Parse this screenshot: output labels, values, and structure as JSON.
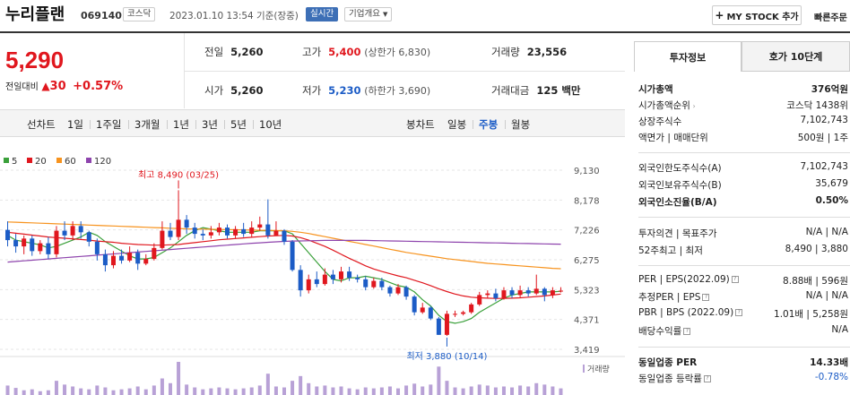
{
  "header": {
    "name": "누리플랜",
    "code": "069140",
    "market": "코스닥",
    "datetime": "2023.01.10 13:54 기준(장중)",
    "realtime": "실시간",
    "overview": "기업개요",
    "overview_icon": "chevron-down-icon",
    "mystock": "MY STOCK 추가",
    "quick": "빠른주문"
  },
  "price": {
    "current": "5,290",
    "diff_label": "전일대비",
    "diff": "30",
    "rate": "+0.57%",
    "up_color": "#e0171e",
    "down_color": "#1c5cc6"
  },
  "quote": {
    "prev_label": "전일",
    "prev": "5,260",
    "high_label": "고가",
    "high": "5,400",
    "upper_limit": "(상한가 6,830)",
    "volume_label": "거래량",
    "volume": "23,556",
    "open_label": "시가",
    "open": "5,260",
    "low_label": "저가",
    "low": "5,230",
    "lower_limit": "(하한가 3,690)",
    "amount_label": "거래대금",
    "amount": "125 백만"
  },
  "period": {
    "line_label": "선차트",
    "line_items": [
      "1일",
      "1주일",
      "3개월",
      "1년",
      "3년",
      "5년",
      "10년"
    ],
    "candle_label": "봉차트",
    "candle_items": [
      "일봉",
      "주봉",
      "월봉"
    ],
    "candle_selected": "주봉"
  },
  "chart_data": {
    "type": "candlestick",
    "legend": [
      {
        "name": "5",
        "color": "#3aa03a"
      },
      {
        "name": "20",
        "color": "#e0171e"
      },
      {
        "name": "60",
        "color": "#f7931e"
      },
      {
        "name": "120",
        "color": "#8e44ad"
      }
    ],
    "y_ticks": [
      "9,130",
      "8,178",
      "7,226",
      "6,275",
      "5,323",
      "4,371",
      "3,419"
    ],
    "ylim": [
      3419,
      9130
    ],
    "high_label": "최고 8,490 (03/25)",
    "low_label": "최저 3,880 (10/14)",
    "volume_label": "거래량",
    "candles": [
      [
        7226,
        6900,
        7500,
        6700
      ],
      [
        6900,
        6700,
        7100,
        6500
      ],
      [
        6700,
        6950,
        7050,
        6450
      ],
      [
        6950,
        6550,
        7050,
        6400
      ],
      [
        6550,
        6800,
        6900,
        6450
      ],
      [
        6800,
        6450,
        7000,
        6300
      ],
      [
        6450,
        7200,
        7350,
        6350
      ],
      [
        7200,
        7050,
        7500,
        6900
      ],
      [
        7050,
        7350,
        7500,
        6900
      ],
      [
        7350,
        7150,
        7500,
        6950
      ],
      [
        7150,
        6850,
        7200,
        6700
      ],
      [
        6850,
        6450,
        6950,
        6250
      ],
      [
        6450,
        6100,
        6600,
        5900
      ],
      [
        6100,
        6400,
        6550,
        6000
      ],
      [
        6400,
        6250,
        6600,
        6150
      ],
      [
        6250,
        6500,
        6700,
        6200
      ],
      [
        6500,
        6150,
        6600,
        5950
      ],
      [
        6150,
        6300,
        6450,
        6100
      ],
      [
        6300,
        6650,
        6800,
        6250
      ],
      [
        6650,
        7200,
        7500,
        6600
      ],
      [
        7200,
        7000,
        7450,
        6900
      ],
      [
        7000,
        7550,
        8490,
        6900
      ],
      [
        7550,
        7300,
        7700,
        7100
      ],
      [
        7300,
        7100,
        7450,
        6950
      ],
      [
        7100,
        7050,
        7250,
        6900
      ],
      [
        7050,
        7150,
        7350,
        6950
      ],
      [
        7150,
        7300,
        7450,
        7050
      ],
      [
        7300,
        7050,
        7400,
        6950
      ],
      [
        7050,
        7250,
        7350,
        6950
      ],
      [
        7250,
        7100,
        7450,
        7000
      ],
      [
        7100,
        7300,
        7500,
        7000
      ],
      [
        7300,
        7400,
        7650,
        7200
      ],
      [
        7400,
        7050,
        8200,
        6950
      ],
      [
        7050,
        7200,
        7500,
        7050
      ],
      [
        7200,
        6850,
        7250,
        6750
      ],
      [
        6850,
        5950,
        6900,
        5900
      ],
      [
        5950,
        5300,
        6100,
        5100
      ],
      [
        5300,
        5650,
        5800,
        5200
      ],
      [
        5650,
        5500,
        5900,
        5400
      ],
      [
        5500,
        5800,
        6000,
        5450
      ],
      [
        5800,
        5650,
        5950,
        5500
      ],
      [
        5650,
        5900,
        6050,
        5550
      ],
      [
        5900,
        5700,
        6050,
        5600
      ],
      [
        5700,
        5650,
        5800,
        5550
      ],
      [
        5650,
        5400,
        5750,
        5300
      ],
      [
        5400,
        5600,
        5700,
        5350
      ],
      [
        5600,
        5400,
        5700,
        5300
      ],
      [
        5400,
        5200,
        5450,
        5100
      ],
      [
        5200,
        5400,
        5500,
        5150
      ],
      [
        5400,
        5100,
        5450,
        5000
      ],
      [
        5100,
        4600,
        5150,
        4500
      ],
      [
        4600,
        4750,
        4900,
        4550
      ],
      [
        4750,
        4400,
        4800,
        4350
      ],
      [
        4400,
        3880,
        4450,
        3880
      ],
      [
        3880,
        4550,
        4650,
        3850
      ],
      [
        4550,
        4550,
        4650,
        4450
      ],
      [
        4550,
        4600,
        4650,
        4500
      ],
      [
        4600,
        4850,
        4900,
        4550
      ],
      [
        4850,
        5150,
        5250,
        4800
      ],
      [
        5150,
        5200,
        5300,
        5050
      ],
      [
        5200,
        5050,
        5350,
        4950
      ],
      [
        5050,
        5300,
        5400,
        5000
      ],
      [
        5300,
        5150,
        5400,
        5050
      ],
      [
        5150,
        5300,
        5450,
        5050
      ],
      [
        5300,
        5200,
        5400,
        5100
      ],
      [
        5200,
        5350,
        5800,
        5150
      ],
      [
        5350,
        5150,
        5400,
        4950
      ],
      [
        5150,
        5300,
        5400,
        5050
      ],
      [
        5260,
        5290,
        5400,
        5230
      ]
    ],
    "ma": {
      "5": [
        7050,
        6900,
        6850,
        6800,
        6750,
        6650,
        6700,
        6800,
        6900,
        7000,
        7150,
        7050,
        6850,
        6700,
        6550,
        6400,
        6300,
        6300,
        6350,
        6500,
        6650,
        6850,
        7050,
        7200,
        7300,
        7250,
        7200,
        7150,
        7150,
        7150,
        7150,
        7200,
        7200,
        7200,
        7200,
        7100,
        6800,
        6500,
        6200,
        5900,
        5650,
        5600,
        5700,
        5700,
        5750,
        5700,
        5650,
        5550,
        5450,
        5400,
        5250,
        5000,
        4800,
        4500,
        4300,
        4250,
        4300,
        4400,
        4600,
        4750,
        4900,
        5050,
        5150,
        5200,
        5250,
        5250,
        5250,
        5250,
        5270
      ],
      "20": [
        7150,
        7120,
        7090,
        7060,
        7030,
        7000,
        6980,
        6960,
        6940,
        6920,
        6900,
        6870,
        6850,
        6830,
        6800,
        6780,
        6760,
        6750,
        6740,
        6740,
        6750,
        6760,
        6790,
        6820,
        6850,
        6880,
        6910,
        6930,
        6950,
        6970,
        6990,
        7010,
        7030,
        7040,
        7050,
        7030,
        6980,
        6900,
        6800,
        6700,
        6580,
        6450,
        6320,
        6200,
        6080,
        5980,
        5900,
        5830,
        5760,
        5700,
        5620,
        5540,
        5450,
        5350,
        5260,
        5180,
        5120,
        5080,
        5060,
        5050,
        5040,
        5040,
        5050,
        5060,
        5080,
        5100,
        5120,
        5150,
        5180
      ],
      "60": [
        7480,
        7470,
        7460,
        7450,
        7440,
        7430,
        7420,
        7410,
        7400,
        7390,
        7380,
        7370,
        7360,
        7350,
        7340,
        7330,
        7320,
        7310,
        7300,
        7290,
        7280,
        7270,
        7260,
        7255,
        7250,
        7245,
        7240,
        7235,
        7230,
        7225,
        7220,
        7215,
        7210,
        7205,
        7200,
        7180,
        7150,
        7110,
        7060,
        7010,
        6960,
        6910,
        6860,
        6810,
        6760,
        6710,
        6660,
        6610,
        6560,
        6510,
        6470,
        6430,
        6390,
        6350,
        6310,
        6280,
        6250,
        6220,
        6190,
        6160,
        6140,
        6120,
        6100,
        6080,
        6060,
        6040,
        6020,
        6000,
        5990
      ],
      "120": [
        6200,
        6220,
        6240,
        6260,
        6280,
        6300,
        6320,
        6340,
        6360,
        6380,
        6400,
        6420,
        6440,
        6460,
        6480,
        6500,
        6520,
        6540,
        6560,
        6580,
        6600,
        6620,
        6640,
        6660,
        6680,
        6700,
        6720,
        6740,
        6760,
        6780,
        6800,
        6815,
        6830,
        6845,
        6860,
        6870,
        6875,
        6880,
        6885,
        6890,
        6890,
        6890,
        6890,
        6890,
        6890,
        6885,
        6880,
        6875,
        6870,
        6865,
        6860,
        6855,
        6850,
        6845,
        6840,
        6835,
        6830,
        6825,
        6820,
        6815,
        6810,
        6805,
        6800,
        6795,
        6790,
        6785,
        6780,
        6775,
        6770
      ]
    },
    "volume": [
      20,
      15,
      10,
      12,
      8,
      10,
      30,
      22,
      18,
      14,
      12,
      20,
      16,
      10,
      12,
      14,
      18,
      12,
      20,
      35,
      25,
      70,
      22,
      16,
      12,
      14,
      16,
      14,
      12,
      14,
      16,
      20,
      45,
      18,
      16,
      30,
      40,
      25,
      18,
      20,
      16,
      18,
      14,
      12,
      16,
      14,
      16,
      18,
      14,
      20,
      24,
      18,
      22,
      60,
      30,
      16,
      14,
      18,
      22,
      20,
      16,
      18,
      16,
      20,
      18,
      25,
      22,
      18,
      14
    ]
  },
  "info_panel": {
    "tab_active": "투자정보",
    "tab2": "호가 10단계",
    "market_cap_label": "시가총액",
    "market_cap": "376억원",
    "rank_label": "시가총액순위",
    "rank": "코스닥 1438위",
    "shares_label": "상장주식수",
    "shares": "7,102,743",
    "par_label": "액면가 | 매매단위",
    "par": "500원 | 1주",
    "foreign_limit_label": "외국인한도주식수(A)",
    "foreign_limit": "7,102,743",
    "foreign_hold_label": "외국인보유주식수(B)",
    "foreign_hold": "35,679",
    "foreign_ratio_label": "외국인소진율(B/A)",
    "foreign_ratio": "0.50%",
    "opinion_label": "투자의견 | 목표주가",
    "opinion": "N/A | N/A",
    "wk52_label": "52주최고 | 최저",
    "wk52": "8,490 | 3,880",
    "per_label": "PER | EPS(2022.09)",
    "per": "8.88배 | 596원",
    "est_per_label": "추정PER | EPS",
    "est_per": "N/A | N/A",
    "pbr_label": "PBR | BPS (2022.09)",
    "pbr": "1.01배 | 5,258원",
    "div_label": "배당수익률",
    "div": "N/A",
    "sector_per_label": "동일업종 PER",
    "sector_per": "14.33배",
    "sector_rate_label": "동일업종 등락률",
    "sector_rate": "-0.78%"
  }
}
